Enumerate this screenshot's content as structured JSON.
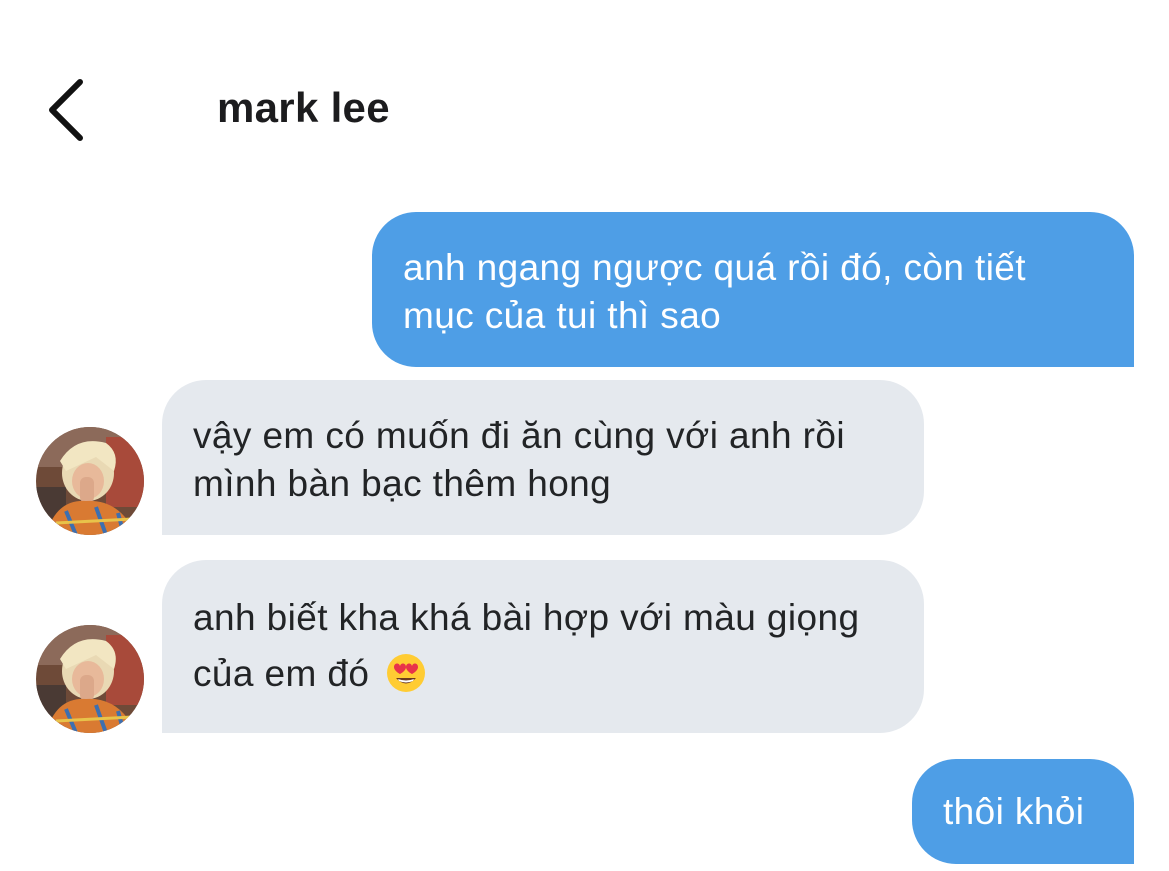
{
  "header": {
    "back_icon": "chevron-left-icon",
    "title": "mark lee"
  },
  "contact": {
    "avatar_icon": "avatar"
  },
  "messages": [
    {
      "side": "sent",
      "text": "anh ngang ngược quá rồi đó, còn tiết mục của tui thì sao"
    },
    {
      "side": "received",
      "text": "vậy em có muốn đi ăn cùng với anh rồi mình bàn bạc thêm hong"
    },
    {
      "side": "received",
      "text": "anh biết kha khá bài hợp với màu giọng của em đó",
      "emoji": "heart-eyes-emoji"
    },
    {
      "side": "sent",
      "text": "thôi khỏi"
    }
  ],
  "colors": {
    "sent_bubble": "#4e9ee6",
    "received_bubble": "#e5e9ee",
    "sent_text": "#ffffff",
    "received_text": "#222426"
  }
}
